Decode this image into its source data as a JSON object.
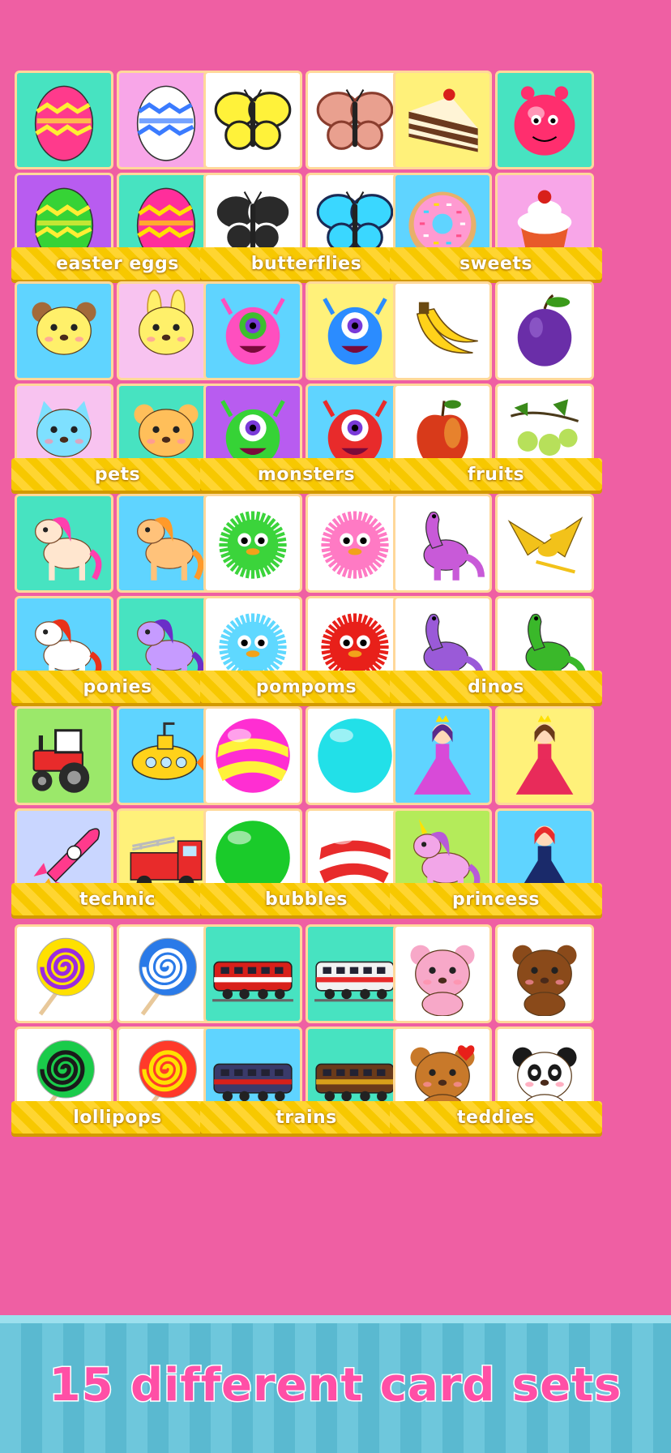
{
  "card_sets": [
    {
      "label": "easter eggs",
      "tiles": [
        {
          "bg": "#47e3c1",
          "icon": "easter-egg-icon",
          "c1": "#ff3a8c",
          "c2": "#ffee33"
        },
        {
          "bg": "#f8a6e8",
          "icon": "easter-egg-icon",
          "c1": "#ffffff",
          "c2": "#3a7bff"
        },
        {
          "bg": "#b85cf0",
          "icon": "easter-egg-icon",
          "c1": "#36d336",
          "c2": "#ffee33"
        },
        {
          "bg": "#47e3c1",
          "icon": "easter-egg-icon",
          "c1": "#ff2e9b",
          "c2": "#ffe000"
        }
      ]
    },
    {
      "label": "butterflies",
      "tiles": [
        {
          "bg": "#ffffff",
          "icon": "butterfly-icon",
          "c1": "#fff23a",
          "c2": "#222222"
        },
        {
          "bg": "#ffffff",
          "icon": "butterfly-icon",
          "c1": "#e9a08f",
          "c2": "#8a3d2e"
        },
        {
          "bg": "#ffffff",
          "icon": "butterfly-icon",
          "c1": "#2a2a2a",
          "c2": "#ffffff"
        },
        {
          "bg": "#ffffff",
          "icon": "butterfly-icon",
          "c1": "#3ad7ff",
          "c2": "#1a2a55"
        }
      ]
    },
    {
      "label": "sweets",
      "tiles": [
        {
          "bg": "#fff17a",
          "icon": "cake-icon",
          "c1": "#6b3a1f",
          "c2": "#fff4d6"
        },
        {
          "bg": "#47e3c1",
          "icon": "candy-monster-icon",
          "c1": "#ff2e6e",
          "c2": "#ffffff"
        },
        {
          "bg": "#5fd4ff",
          "icon": "donut-icon",
          "c1": "#ff9ad1",
          "c2": "#e8b06a"
        },
        {
          "bg": "#f8a6e8",
          "icon": "cupcake-icon",
          "c1": "#ffffff",
          "c2": "#e85a2a"
        }
      ]
    },
    {
      "label": "pets",
      "tiles": [
        {
          "bg": "#5fd4ff",
          "icon": "puppy-icon",
          "c1": "#fff06a",
          "c2": "#a36a3a"
        },
        {
          "bg": "#f8c3f0",
          "icon": "bunny-icon",
          "c1": "#fff06a",
          "c2": "#ff8fc9"
        },
        {
          "bg": "#f8c3f0",
          "icon": "kitten-icon",
          "c1": "#7ee0ff",
          "c2": "#ffffff"
        },
        {
          "bg": "#47e3c1",
          "icon": "hamster-icon",
          "c1": "#ffbf5a",
          "c2": "#ffffff"
        }
      ]
    },
    {
      "label": "monsters",
      "tiles": [
        {
          "bg": "#5fd4ff",
          "icon": "monster-icon",
          "c1": "#ff4fbf",
          "c2": "#3dbf2e"
        },
        {
          "bg": "#fff17a",
          "icon": "monster-icon",
          "c1": "#2b8cff",
          "c2": "#ffffff"
        },
        {
          "bg": "#b85cf0",
          "icon": "monster-icon",
          "c1": "#36d336",
          "c2": "#ffffff"
        },
        {
          "bg": "#5fd4ff",
          "icon": "monster-icon",
          "c1": "#e82b2b",
          "c2": "#ffffff"
        }
      ]
    },
    {
      "label": "fruits",
      "tiles": [
        {
          "bg": "#ffffff",
          "icon": "banana-icon",
          "c1": "#ffd21a",
          "c2": "#6b4a12"
        },
        {
          "bg": "#ffffff",
          "icon": "plum-icon",
          "c1": "#6a2ea8",
          "c2": "#3a9a1a"
        },
        {
          "bg": "#ffffff",
          "icon": "apple-icon",
          "c1": "#d83a1a",
          "c2": "#f2b23a"
        },
        {
          "bg": "#ffffff",
          "icon": "gooseberry-icon",
          "c1": "#b7e05a",
          "c2": "#3a8a1a"
        }
      ]
    },
    {
      "label": "ponies",
      "tiles": [
        {
          "bg": "#47e3c1",
          "icon": "pony-icon",
          "c1": "#ffe6cf",
          "c2": "#ff3fae"
        },
        {
          "bg": "#5fd4ff",
          "icon": "pony-icon",
          "c1": "#ffc27a",
          "c2": "#ff9a2a"
        },
        {
          "bg": "#5fd4ff",
          "icon": "pony-icon",
          "c1": "#ffffff",
          "c2": "#e8321a"
        },
        {
          "bg": "#47e3c1",
          "icon": "pony-icon",
          "c1": "#c69bff",
          "c2": "#6a2ec8"
        }
      ]
    },
    {
      "label": "pompoms",
      "tiles": [
        {
          "bg": "#ffffff",
          "icon": "pompom-icon",
          "c1": "#3bd43b",
          "c2": "#ffffff"
        },
        {
          "bg": "#ffffff",
          "icon": "pompom-icon",
          "c1": "#ff7ac4",
          "c2": "#67d8ff"
        },
        {
          "bg": "#ffffff",
          "icon": "pompom-icon",
          "c1": "#5fd8ff",
          "c2": "#ffffff"
        },
        {
          "bg": "#ffffff",
          "icon": "pompom-icon",
          "c1": "#e8201a",
          "c2": "#ffffff"
        }
      ]
    },
    {
      "label": "dinos",
      "tiles": [
        {
          "bg": "#ffffff",
          "icon": "dino-icon",
          "c1": "#c85ad8",
          "c2": "#ffffff"
        },
        {
          "bg": "#ffffff",
          "icon": "pterodactyl-icon",
          "c1": "#f2c21a",
          "c2": "#ffffff"
        },
        {
          "bg": "#ffffff",
          "icon": "dino-icon",
          "c1": "#9a5ad8",
          "c2": "#ffffff"
        },
        {
          "bg": "#ffffff",
          "icon": "dino-icon",
          "c1": "#3ab82a",
          "c2": "#ffffff"
        }
      ]
    },
    {
      "label": "technic",
      "tiles": [
        {
          "bg": "#9be86a",
          "icon": "tractor-icon",
          "c1": "#e82b2b",
          "c2": "#2a2a2a"
        },
        {
          "bg": "#5fd4ff",
          "icon": "submarine-icon",
          "c1": "#ffd21a",
          "c2": "#ff7a1a"
        },
        {
          "bg": "#c9d6ff",
          "icon": "rocket-icon",
          "c1": "#ff3a8c",
          "c2": "#ffffff"
        },
        {
          "bg": "#fff17a",
          "icon": "firetruck-icon",
          "c1": "#e82b2b",
          "c2": "#ffffff"
        }
      ]
    },
    {
      "label": "bubbles",
      "tiles": [
        {
          "bg": "#ffffff",
          "icon": "bubble-icon",
          "c1": "#ff2ed2",
          "c2": "#fff23a"
        },
        {
          "bg": "#ffffff",
          "icon": "bubble-icon",
          "c1": "#22e0e8",
          "c2": "#22e0e8"
        },
        {
          "bg": "#ffffff",
          "icon": "bubble-icon",
          "c1": "#1acb2a",
          "c2": "#1acb2a"
        },
        {
          "bg": "#ffffff",
          "icon": "bubble-icon",
          "c1": "#ffffff",
          "c2": "#e82b2b"
        }
      ]
    },
    {
      "label": "princess",
      "tiles": [
        {
          "bg": "#5fd4ff",
          "icon": "princess-icon",
          "c1": "#d84ad8",
          "c2": "#5a2a8a"
        },
        {
          "bg": "#fff17a",
          "icon": "princess-icon",
          "c1": "#e82b5a",
          "c2": "#6a3a1a"
        },
        {
          "bg": "#b4eb5a",
          "icon": "unicorn-icon",
          "c1": "#f2a6e8",
          "c2": "#b85ad8"
        },
        {
          "bg": "#5fd4ff",
          "icon": "prince-icon",
          "c1": "#1a2a6a",
          "c2": "#e82b2b"
        }
      ]
    },
    {
      "label": "lollipops",
      "tiles": [
        {
          "bg": "#ffffff",
          "icon": "lollipop-icon",
          "c1": "#ffe000",
          "c2": "#9a2ae0"
        },
        {
          "bg": "#ffffff",
          "icon": "lollipop-icon",
          "c1": "#2a7ae8",
          "c2": "#ffffff"
        },
        {
          "bg": "#ffffff",
          "icon": "lollipop-icon",
          "c1": "#1acb4a",
          "c2": "#1a1a1a"
        },
        {
          "bg": "#ffffff",
          "icon": "lollipop-icon",
          "c1": "#ff3a2a",
          "c2": "#ffe000"
        }
      ]
    },
    {
      "label": "trains",
      "tiles": [
        {
          "bg": "#47e3c1",
          "icon": "train-icon",
          "c1": "#d8201a",
          "c2": "#ffffff"
        },
        {
          "bg": "#47e3c1",
          "icon": "train-icon",
          "c1": "#f2f2f2",
          "c2": "#e82b2b"
        },
        {
          "bg": "#5fd4ff",
          "icon": "train-icon",
          "c1": "#3a3a6a",
          "c2": "#d8201a"
        },
        {
          "bg": "#47e3c1",
          "icon": "train-icon",
          "c1": "#6a3a1a",
          "c2": "#d8a01a"
        }
      ]
    },
    {
      "label": "teddies",
      "tiles": [
        {
          "bg": "#ffffff",
          "icon": "teddy-icon",
          "c1": "#f7a8c8",
          "c2": "#ffffff"
        },
        {
          "bg": "#ffffff",
          "icon": "teddy-icon",
          "c1": "#8a4a1a",
          "c2": "#3a7ae8"
        },
        {
          "bg": "#ffffff",
          "icon": "teddy-icon",
          "c1": "#c8792a",
          "c2": "#e8201a"
        },
        {
          "bg": "#ffffff",
          "icon": "panda-icon",
          "c1": "#ffffff",
          "c2": "#1a1a1a"
        }
      ]
    }
  ],
  "banner": {
    "title": "15 different card sets"
  }
}
